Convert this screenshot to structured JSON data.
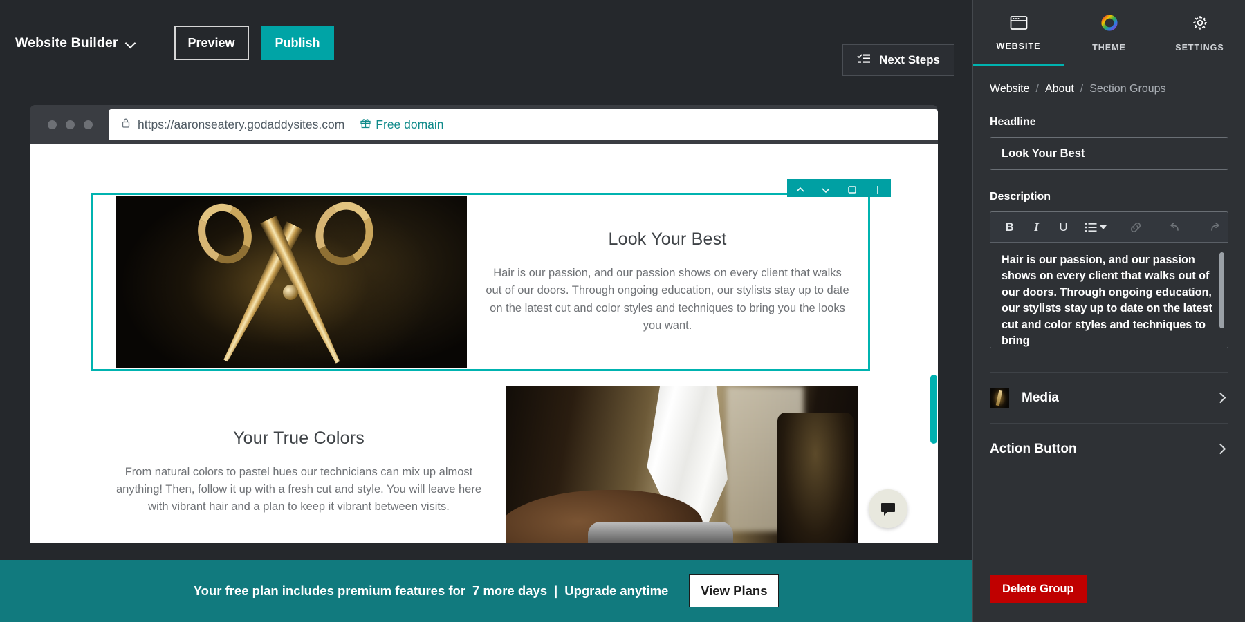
{
  "topbar": {
    "brand_label": "Website Builder",
    "brand_caret_icon": "chevron-down-icon",
    "preview_label": "Preview",
    "publish_label": "Publish",
    "next_steps_label": "Next Steps",
    "next_steps_icon": "checklist-icon",
    "publish_color": "#00a4a6"
  },
  "browser": {
    "lock_icon": "lock-icon",
    "url": "https://aaronseatery.godaddysites.com",
    "free_domain_label": "Free domain",
    "free_domain_icon": "gift-icon",
    "free_domain_color": "#0f8a8a"
  },
  "section_toolbar": {
    "icons": [
      "chevron-up-icon",
      "chevron-down-icon",
      "duplicate-icon",
      "move-icon"
    ],
    "color": "#00a0a3"
  },
  "site": {
    "sections": [
      {
        "heading": "Look Your Best",
        "body": "Hair is our passion, and our passion shows on every client that walks out of our doors. Through ongoing education, our stylists stay up to date on the latest cut and color styles and techniques to bring you the looks you want.",
        "image_alt": "golden-hair-scissors-photo",
        "selected": true,
        "selection_color": "#00b3b0"
      },
      {
        "heading": "Your True Colors",
        "body": "From natural colors to pastel hues our technicians can mix up almost anything! Then, follow it up with a fresh cut and style. You will leave here with vibrant hair and a plan to keep it vibrant between visits.",
        "image_alt": "stylist-hands-with-foil-photo",
        "selected": false
      }
    ],
    "chat_icon": "chat-bubble-icon"
  },
  "promo": {
    "text_before": "Your free plan includes premium features for",
    "days_link": "7 more days",
    "separator": "|",
    "text_after": "Upgrade anytime",
    "button_label": "View Plans",
    "background": "#117a7e"
  },
  "panel": {
    "tabs": [
      {
        "label": "WEBSITE",
        "icon": "browser-window-icon",
        "active": true
      },
      {
        "label": "THEME",
        "icon": "color-wheel-icon",
        "active": false
      },
      {
        "label": "SETTINGS",
        "icon": "gear-icon",
        "active": false
      }
    ],
    "breadcrumb": {
      "root": "Website",
      "sep1": "/",
      "parent": "About",
      "sep2": "/",
      "current": "Section Groups"
    },
    "headline": {
      "label": "Headline",
      "value": "Look Your Best",
      "placeholder": "Headline"
    },
    "description": {
      "label": "Description",
      "value": "Hair is our passion, and our passion shows on every client that walks out of our doors. Through ongoing education, our stylists stay up to date on the latest cut and color styles and techniques to bring",
      "toolbar": [
        {
          "name": "bold",
          "glyph": "B",
          "enabled": true
        },
        {
          "name": "italic",
          "glyph": "I",
          "enabled": true
        },
        {
          "name": "underline",
          "glyph": "U",
          "enabled": true
        },
        {
          "name": "list",
          "glyph": "≔",
          "enabled": true
        },
        {
          "name": "link",
          "glyph": "🔗",
          "enabled": false
        },
        {
          "name": "undo",
          "glyph": "↰",
          "enabled": false
        },
        {
          "name": "redo",
          "glyph": "↱",
          "enabled": false
        }
      ]
    },
    "rows": [
      {
        "label": "Media",
        "thumb": true,
        "chevron_icon": "chevron-right-icon"
      },
      {
        "label": "Action Button",
        "thumb": false,
        "chevron_icon": "chevron-right-icon"
      }
    ],
    "delete_label": "Delete Group",
    "delete_color": "#c00000"
  }
}
